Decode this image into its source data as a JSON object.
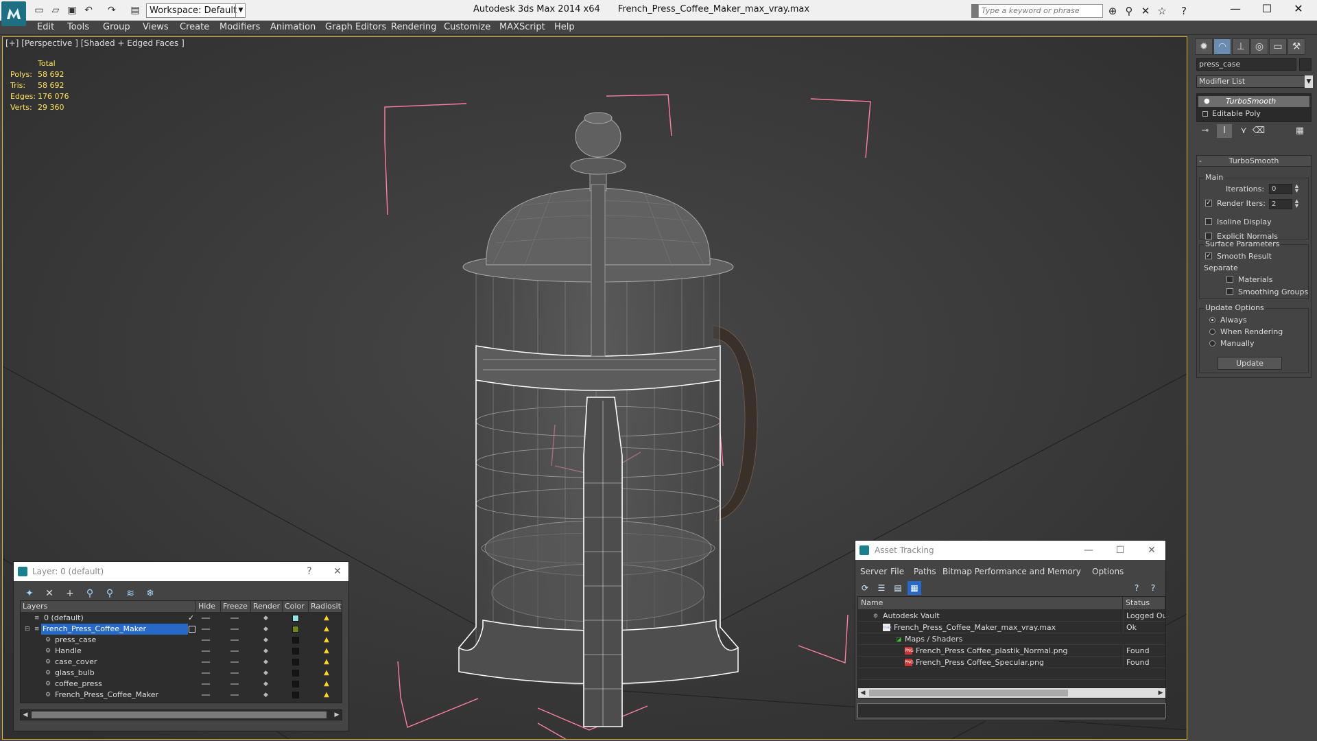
{
  "app": {
    "product": "Autodesk 3ds Max  2014 x64",
    "filename": "French_Press_Coffee_Maker_max_vray.max",
    "workspace": "Workspace: Default",
    "search_placeholder": "Type a keyword or phrase"
  },
  "menu": [
    "Edit",
    "Tools",
    "Group",
    "Views",
    "Create",
    "Modifiers",
    "Animation",
    "Graph Editors",
    "Rendering",
    "Customize",
    "MAXScript",
    "Help"
  ],
  "viewport": {
    "label": "[+] [Perspective ] [Shaded + Edged Faces ]",
    "stats": {
      "total_label": "Total",
      "rows": [
        {
          "k": "Polys:",
          "v": "58 692"
        },
        {
          "k": "Tris:",
          "v": "58 692"
        },
        {
          "k": "Edges:",
          "v": "176 076"
        },
        {
          "k": "Verts:",
          "v": "29 360"
        }
      ]
    }
  },
  "command_panel": {
    "object_name": "press_case",
    "modifier_list": "Modifier List",
    "stack": [
      "TurboSmooth",
      "Editable Poly"
    ],
    "rollout_title": "TurboSmooth",
    "main_label": "Main",
    "iterations_label": "Iterations:",
    "iterations_value": "0",
    "render_iters_label": "Render Iters:",
    "render_iters_value": "2",
    "isoline_label": "Isoline Display",
    "explicit_normals_label": "Explicit Normals",
    "surface_params_label": "Surface Parameters",
    "smooth_result_label": "Smooth Result",
    "separate_label": "Separate",
    "materials_label": "Materials",
    "smoothing_groups_label": "Smoothing Groups",
    "update_options_label": "Update Options",
    "always_label": "Always",
    "when_rendering_label": "When Rendering",
    "manually_label": "Manually",
    "update_button": "Update"
  },
  "layer_dialog": {
    "title": "Layer: 0 (default)",
    "help": "?",
    "headers": [
      "Layers",
      "Hide",
      "Freeze",
      "Render",
      "Color",
      "Radiosity"
    ],
    "rows": [
      {
        "name": "0 (default)",
        "color": "#8fe6e6",
        "indent": 0
      },
      {
        "name": "French_Press_Coffee_Maker",
        "color": "#6f8a14",
        "indent": 0
      },
      {
        "name": "press_case",
        "color": "#151515",
        "indent": 1
      },
      {
        "name": "Handle",
        "color": "#151515",
        "indent": 1
      },
      {
        "name": "case_cover",
        "color": "#151515",
        "indent": 1
      },
      {
        "name": "glass_bulb",
        "color": "#151515",
        "indent": 1
      },
      {
        "name": "coffee_press",
        "color": "#151515",
        "indent": 1
      },
      {
        "name": "French_Press_Coffee_Maker",
        "color": "#151515",
        "indent": 1
      }
    ]
  },
  "asset_dialog": {
    "title": "Asset Tracking",
    "menu": [
      "Server",
      "File",
      "Paths",
      "Bitmap Performance and Memory",
      "Options"
    ],
    "headers": [
      "Name",
      "Status"
    ],
    "rows": [
      {
        "name": "Autodesk Vault",
        "status": "Logged Ou"
      },
      {
        "name": "French_Press_Coffee_Maker_max_vray.max",
        "status": "Ok"
      },
      {
        "name": "Maps / Shaders",
        "status": ""
      },
      {
        "name": "French_Press Coffee_plastik_Normal.png",
        "status": "Found"
      },
      {
        "name": "French_Press Coffee_Specular.png",
        "status": "Found"
      }
    ]
  },
  "colors": {
    "viewport_bg": "#3b3b3b",
    "viewport_border": "#e8b530",
    "stats_text": "#ffe55a",
    "selection_blue": "#2769c6",
    "bbox_pink": "#ff7fa0"
  },
  "icons": [
    "max-logo-icon",
    "new-file-icon",
    "open-file-icon",
    "save-file-icon",
    "undo-icon",
    "redo-icon",
    "binoculars-icon",
    "search-icon",
    "star-icon",
    "help-icon",
    "minimize-icon",
    "maximize-icon",
    "close-icon"
  ]
}
